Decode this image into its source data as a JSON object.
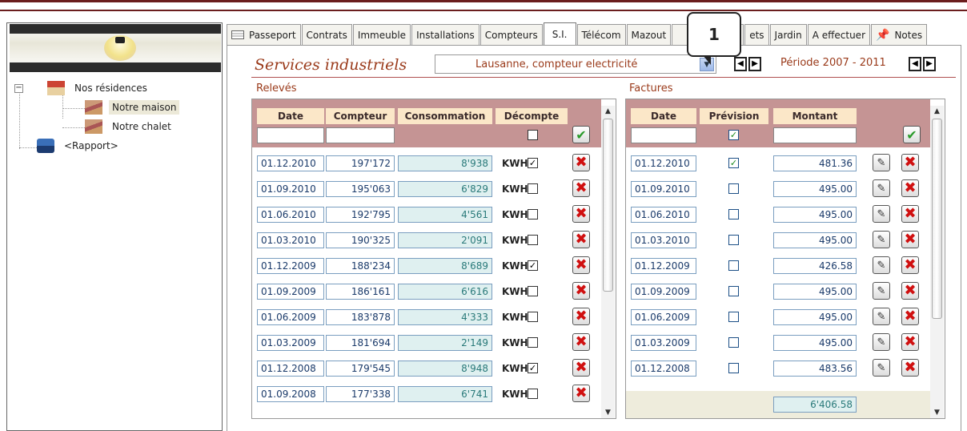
{
  "tree": {
    "root": "Nos résidences",
    "items": [
      "Notre maison",
      "Notre chalet"
    ],
    "report": "<Rapport>"
  },
  "tabs": [
    "Passeport",
    "Contrats",
    "Immeuble",
    "Installations",
    "Compteurs",
    "S.I.",
    "Télécom",
    "Mazout",
    "",
    "ets",
    "Jardin",
    "A effectuer",
    "Notes"
  ],
  "active_tab": "S.I.",
  "header": {
    "title": "Services industriels",
    "meter_select": "Lausanne, compteur electricité",
    "periode": "Période 2007 - 2011",
    "callout": "1"
  },
  "releves": {
    "section_title": "Relevés",
    "columns": [
      "Date",
      "Compteur",
      "Consommation",
      "Décompte"
    ],
    "rows": [
      {
        "date": "01.12.2010",
        "compteur": "197'172",
        "consommation": "8'938",
        "unit": "KWH",
        "decompte": true
      },
      {
        "date": "01.09.2010",
        "compteur": "195'063",
        "consommation": "6'829",
        "unit": "KWH",
        "decompte": false
      },
      {
        "date": "01.06.2010",
        "compteur": "192'795",
        "consommation": "4'561",
        "unit": "KWH",
        "decompte": false
      },
      {
        "date": "01.03.2010",
        "compteur": "190'325",
        "consommation": "2'091",
        "unit": "KWH",
        "decompte": false
      },
      {
        "date": "01.12.2009",
        "compteur": "188'234",
        "consommation": "8'689",
        "unit": "KWH",
        "decompte": true
      },
      {
        "date": "01.09.2009",
        "compteur": "186'161",
        "consommation": "6'616",
        "unit": "KWH",
        "decompte": false
      },
      {
        "date": "01.06.2009",
        "compteur": "183'878",
        "consommation": "4'333",
        "unit": "KWH",
        "decompte": false
      },
      {
        "date": "01.03.2009",
        "compteur": "181'694",
        "consommation": "2'149",
        "unit": "KWH",
        "decompte": false
      },
      {
        "date": "01.12.2008",
        "compteur": "179'545",
        "consommation": "8'948",
        "unit": "KWH",
        "decompte": true
      },
      {
        "date": "01.09.2008",
        "compteur": "177'338",
        "consommation": "6'741",
        "unit": "KWH",
        "decompte": false
      }
    ]
  },
  "factures": {
    "section_title": "Factures",
    "columns": [
      "Date",
      "Prévision",
      "Montant"
    ],
    "rows": [
      {
        "date": "01.12.2010",
        "prevision": true,
        "montant": "481.36"
      },
      {
        "date": "01.09.2010",
        "prevision": false,
        "montant": "495.00"
      },
      {
        "date": "01.06.2010",
        "prevision": false,
        "montant": "495.00"
      },
      {
        "date": "01.03.2010",
        "prevision": false,
        "montant": "495.00"
      },
      {
        "date": "01.12.2009",
        "prevision": false,
        "montant": "426.58"
      },
      {
        "date": "01.09.2009",
        "prevision": false,
        "montant": "495.00"
      },
      {
        "date": "01.06.2009",
        "prevision": false,
        "montant": "495.00"
      },
      {
        "date": "01.03.2009",
        "prevision": false,
        "montant": "495.00"
      },
      {
        "date": "01.12.2008",
        "prevision": false,
        "montant": "483.56"
      }
    ],
    "total": "6'406.58"
  },
  "colors": {
    "accent": "#9a3a1a",
    "header_band": "#c59494",
    "header_cell": "#fbe7c8",
    "delete": "#d01010",
    "confirm": "#2a9a2a"
  }
}
